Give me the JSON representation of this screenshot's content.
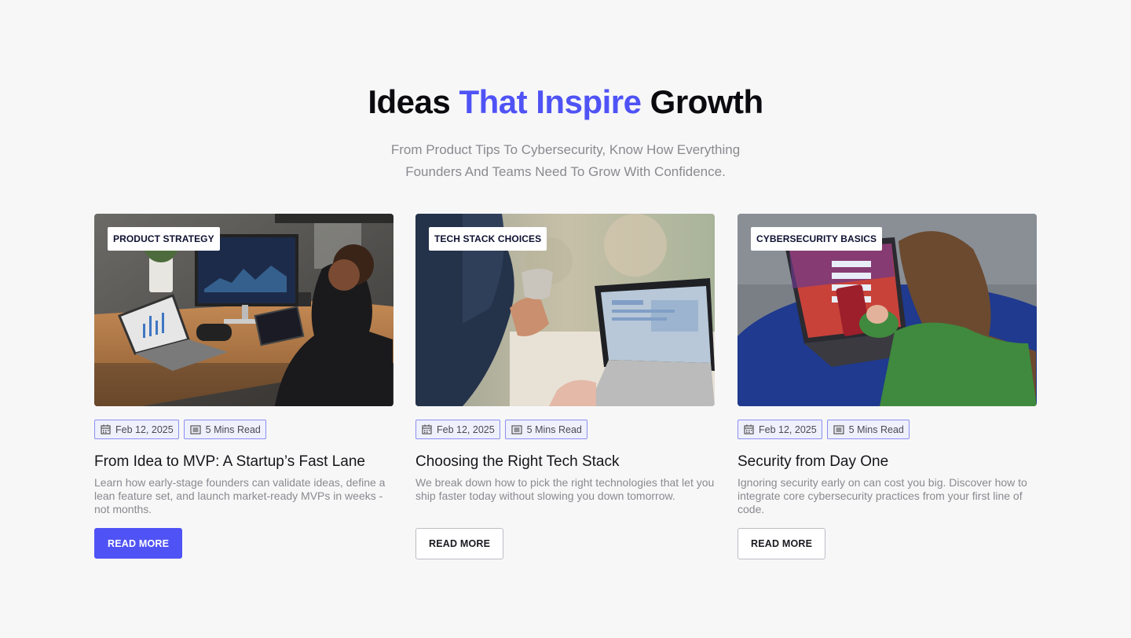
{
  "section": {
    "heading_before": "Ideas",
    "heading_accent": "That Inspire",
    "heading_after": "Growth",
    "subtitle_line1": "From Product Tips To Cybersecurity, Know How Everything",
    "subtitle_line2": "Founders And Teams Need To Grow With Confidence."
  },
  "colors": {
    "accent": "#4f53f5",
    "chip_border": "#8b8ff0",
    "background": "#f7f7f8"
  },
  "cards": [
    {
      "tag": "PRODUCT STRATEGY",
      "date": "Feb 12, 2025",
      "read_time": "5 Mins Read",
      "title": "From Idea to MVP: A Startup’s Fast Lane",
      "description": "Learn how early-stage founders can validate ideas, define a lean feature set, and launch market-ready MVPs in weeks - not months.",
      "button": "READ MORE",
      "image_icon": "office-desk-laptop-monitor-photo"
    },
    {
      "tag": "TECH STACK CHOICES",
      "date": "Feb 12, 2025",
      "read_time": "5 Mins Read",
      "title": "Choosing the Right Tech Stack",
      "description": "We break down how to pick the right technologies that let you ship faster today without slowing you down tomorrow.",
      "button": "READ MORE",
      "image_icon": "coffee-cup-laptop-photo"
    },
    {
      "tag": "CYBERSECURITY BASICS",
      "date": "Feb 12, 2025",
      "read_time": "5 Mins Read",
      "title": "Security from Day One",
      "description": "Ignoring security early on can cost you big. Discover how to integrate core cybersecurity practices from your first line of code.",
      "button": "READ MORE",
      "image_icon": "woman-phone-laptop-photo"
    }
  ]
}
